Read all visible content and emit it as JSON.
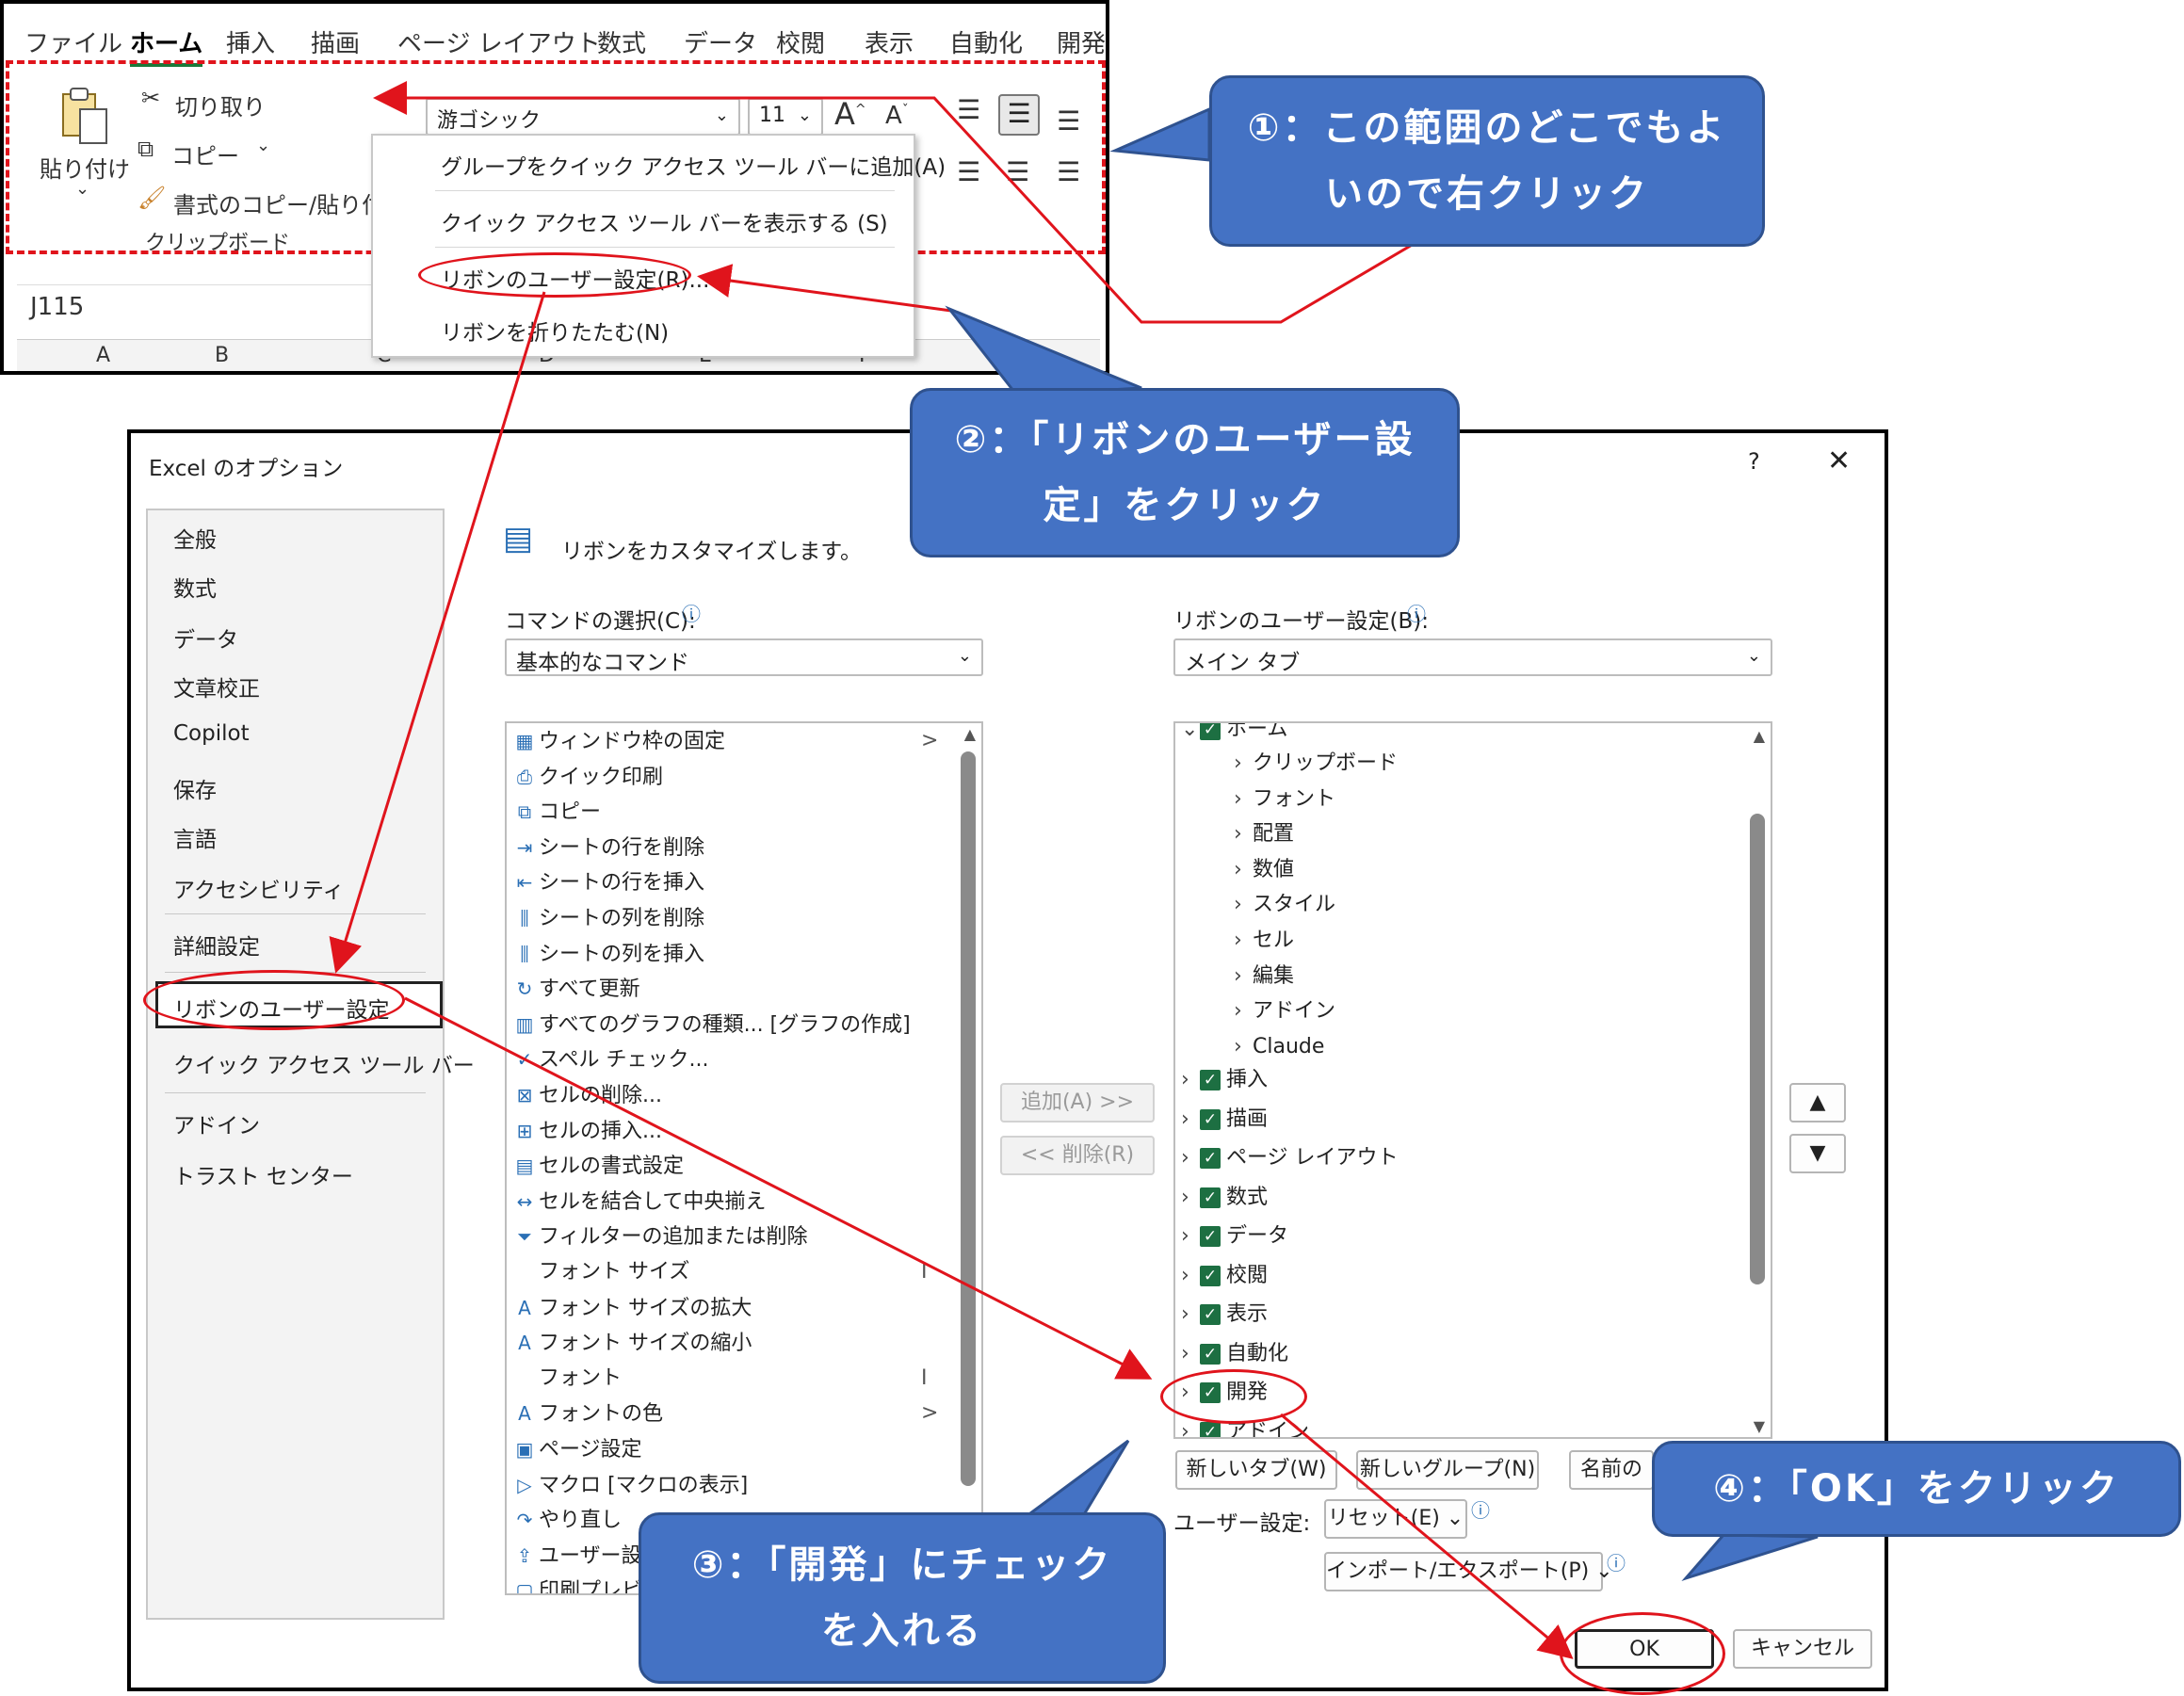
{
  "ribbon": {
    "tabs": [
      "ファイル",
      "ホーム",
      "挿入",
      "描画",
      "ページ レイアウト",
      "数式",
      "データ",
      "校閲",
      "表示",
      "自動化",
      "開発"
    ],
    "active_tab": "ホーム",
    "paste_label": "貼り付け",
    "cut_label": "切り取り",
    "copy_label": "コピー",
    "format_painter_label": "書式のコピー/貼り付け",
    "clipboard_group_label": "クリップボード",
    "font_name": "游ゴシック",
    "font_size": "11",
    "name_box": "J115",
    "columns": [
      "A",
      "B",
      "C",
      "D",
      "E",
      "F"
    ]
  },
  "context_menu": {
    "items": [
      "グループをクイック アクセス ツール バーに追加(A)",
      "クイック アクセス ツール バーを表示する (S)",
      "リボンのユーザー設定(R)...",
      "リボンを折りたたむ(N)"
    ]
  },
  "dialog": {
    "title": "Excel のオプション",
    "help": "?",
    "close": "✕",
    "nav": [
      "全般",
      "数式",
      "データ",
      "文章校正",
      "Copilot",
      "保存",
      "言語",
      "アクセシビリティ",
      "詳細設定",
      "リボンのユーザー設定",
      "クイック アクセス ツール バー",
      "アドイン",
      "トラスト センター"
    ],
    "nav_selected": "リボンのユーザー設定",
    "heading": "リボンをカスタマイズします。",
    "commands_label": "コマンドの選択(C):",
    "commands_value": "基本的なコマンド",
    "customize_label": "リボンのユーザー設定(B):",
    "customize_value": "メイン タブ",
    "commands": [
      {
        "icon": "▦",
        "label": "ウィンドウ枠の固定",
        "arrow": ">"
      },
      {
        "icon": "⎙",
        "label": "クイック印刷",
        "arrow": ""
      },
      {
        "icon": "⧉",
        "label": "コピー",
        "arrow": ""
      },
      {
        "icon": "⇥",
        "label": "シートの行を削除",
        "arrow": ""
      },
      {
        "icon": "⇤",
        "label": "シートの行を挿入",
        "arrow": ""
      },
      {
        "icon": "⫼",
        "label": "シートの列を削除",
        "arrow": ""
      },
      {
        "icon": "⫼",
        "label": "シートの列を挿入",
        "arrow": ""
      },
      {
        "icon": "↻",
        "label": "すべて更新",
        "arrow": ""
      },
      {
        "icon": "▥",
        "label": "すべてのグラフの種類... [グラフの作成]",
        "arrow": ""
      },
      {
        "icon": "✓",
        "label": "スペル チェック...",
        "arrow": ""
      },
      {
        "icon": "⊠",
        "label": "セルの削除...",
        "arrow": ""
      },
      {
        "icon": "⊞",
        "label": "セルの挿入...",
        "arrow": ""
      },
      {
        "icon": "▤",
        "label": "セルの書式設定",
        "arrow": ""
      },
      {
        "icon": "↔",
        "label": "セルを結合して中央揃え",
        "arrow": ""
      },
      {
        "icon": "⏷",
        "label": "フィルターの追加または削除",
        "arrow": ""
      },
      {
        "icon": "",
        "label": "フォント サイズ",
        "arrow": "I"
      },
      {
        "icon": "A",
        "label": "フォント サイズの拡大",
        "arrow": ""
      },
      {
        "icon": "A",
        "label": "フォント サイズの縮小",
        "arrow": ""
      },
      {
        "icon": "",
        "label": "フォント",
        "arrow": "I"
      },
      {
        "icon": "A",
        "label": "フォントの色",
        "arrow": ">"
      },
      {
        "icon": "▣",
        "label": "ページ設定",
        "arrow": ""
      },
      {
        "icon": "▷",
        "label": "マクロ [マクロの表示]",
        "arrow": ""
      },
      {
        "icon": "↷",
        "label": "やり直し",
        "arrow": ""
      },
      {
        "icon": "⇪",
        "label": "ユーザー設",
        "arrow": ""
      },
      {
        "icon": "▢",
        "label": "印刷プレビ",
        "arrow": ""
      }
    ],
    "tree_top": "ホーム",
    "home_groups": [
      "クリップボード",
      "フォント",
      "配置",
      "数値",
      "スタイル",
      "セル",
      "編集",
      "アドイン",
      "Claude"
    ],
    "tabs_tree": [
      "挿入",
      "描画",
      "ページ レイアウト",
      "数式",
      "データ",
      "校閲",
      "表示",
      "自動化",
      "開発",
      "アドイン"
    ],
    "add_button": "追加(A) >>",
    "remove_button": "<< 削除(R)",
    "new_tab_button": "新しいタブ(W)",
    "new_group_button": "新しいグループ(N)",
    "rename_button": "名前の",
    "user_settings_label": "ユーザー設定:",
    "reset_button": "リセット(E)",
    "import_export_button": "インポート/エクスポート(P)",
    "ok_button": "OK",
    "cancel_button": "キャンセル",
    "up_arrow": "▲",
    "down_arrow": "▼"
  },
  "callouts": {
    "step1": "①：この範囲のどこでもよいので右クリック",
    "step2": "②：「リボンのユーザー設定」をクリック",
    "step3": "③：「開発」にチェックを入れる",
    "step4": "④：「OK」をクリック"
  },
  "colors": {
    "accent_red": "#e0141c",
    "callout_blue": "#4472c4",
    "check_green": "#1d6f42"
  }
}
